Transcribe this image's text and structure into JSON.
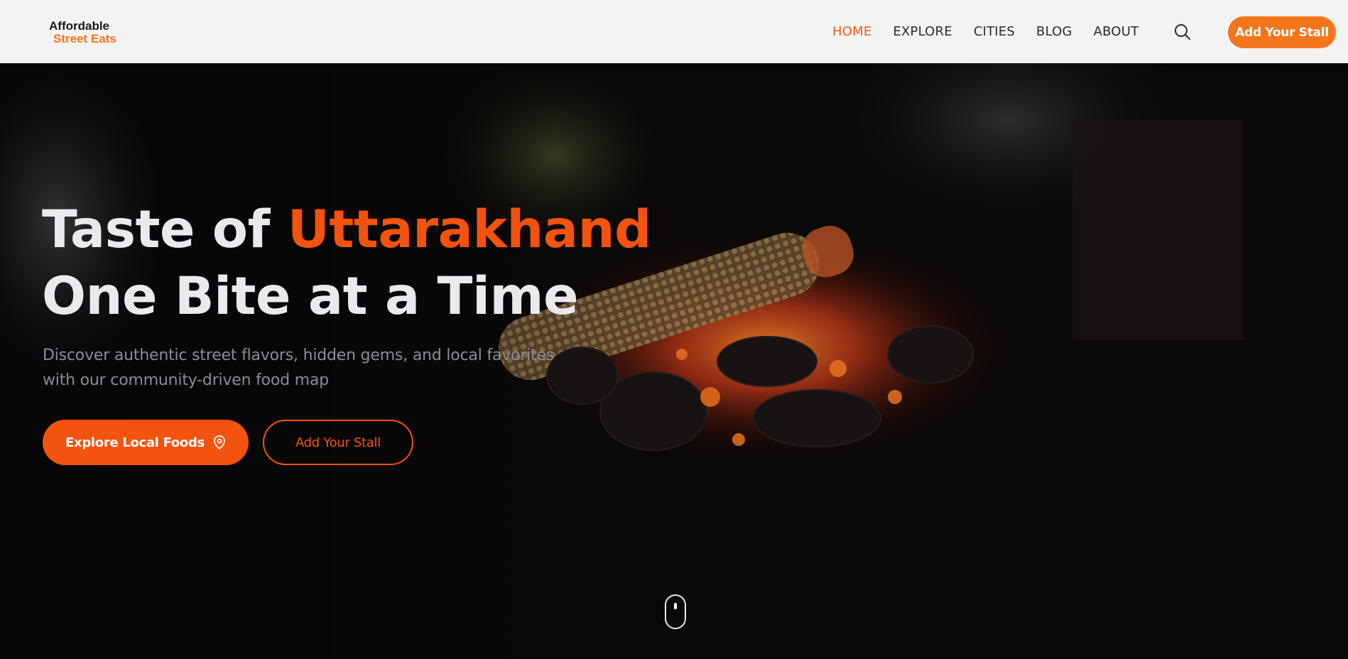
{
  "brand": {
    "line1": "Affordable",
    "line2": "Street Eats"
  },
  "nav": {
    "items": [
      {
        "label": "HOME",
        "active": true
      },
      {
        "label": "EXPLORE",
        "active": false
      },
      {
        "label": "CITIES",
        "active": false
      },
      {
        "label": "BLOG",
        "active": false
      },
      {
        "label": "ABOUT",
        "active": false
      }
    ],
    "search_icon": "search-icon",
    "cta_label": "Add Your Stall"
  },
  "hero": {
    "headline_prefix": "Taste of ",
    "headline_accent": "Uttarakhand",
    "headline_line2": "One Bite at a Time",
    "subtitle": "Discover authentic street flavors, hidden gems, and local favorites with our community-driven food map",
    "primary_button": "Explore Local Foods",
    "primary_button_icon": "map-pin-icon",
    "secondary_button": "Add Your Stall",
    "scroll_icon": "mouse-scroll-icon"
  },
  "colors": {
    "accent": "#f4520f",
    "header_cta": "#f4761c",
    "nav_active": "#ee5a1d",
    "header_bg": "#f3f3f3",
    "hero_bg": "#0a0808"
  }
}
